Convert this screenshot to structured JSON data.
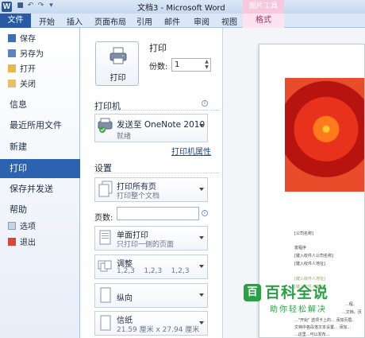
{
  "window": {
    "title": "文档3 - Microsoft Word",
    "app_icon": "W",
    "context_tools": "图片工具"
  },
  "ribbon": {
    "tabs": [
      "文件",
      "开始",
      "插入",
      "页面布局",
      "引用",
      "邮件",
      "审阅",
      "视图",
      "格式"
    ]
  },
  "nav": {
    "small_items": [
      "保存",
      "另存为",
      "打开",
      "关闭"
    ],
    "big_items": [
      "信息",
      "最近所用文件",
      "新建",
      "打印",
      "保存并发送",
      "帮助"
    ],
    "bottom_items": [
      "选项",
      "退出"
    ],
    "active": "打印"
  },
  "print": {
    "button_label": "打印",
    "section_title": "打印",
    "copies_label": "份数:",
    "copies_value": "1",
    "printer_title": "打印机",
    "printer_name": "发送至 OneNote 2010",
    "printer_status": "就绪",
    "printer_props": "打印机属性",
    "settings_title": "设置",
    "settings": [
      {
        "t1": "打印所有页",
        "t2": "打印整个文档"
      },
      {
        "t1": "单面打印",
        "t2": "只打印一侧的页面"
      },
      {
        "t1": "调整",
        "t2": "1,2,3    1,2,3    1,2,3"
      },
      {
        "t1": "纵向",
        "t2": ""
      },
      {
        "t1": "信纸",
        "t2": "21.59 厘米 x 27.94 厘米"
      }
    ],
    "pages_label": "页数:",
    "pages_value": ""
  },
  "preview": {
    "lines": [
      "[公司名称]",
      "富程序",
      "[键入收件人公司名称]",
      "[键入收件人地址]",
      "[键入收件人地址]",
      "[键入收件人地址]",
      "...程、",
      "...文档、页",
      "...\"开始\" 选项卡上的... 添加页眉、",
      "文档中各段落文本设置... 添加...",
      "...这里...可以发布..."
    ]
  },
  "watermark": {
    "logo_char": "百",
    "main": "百科全说",
    "sub": "助你轻松解决"
  },
  "colors": {
    "file_tab": "#2a5aa4",
    "nav_active": "#2b63b0",
    "context_tab": "#f7c7dd",
    "watermark": "#2aa146",
    "photo_flower": "#e9321b"
  }
}
